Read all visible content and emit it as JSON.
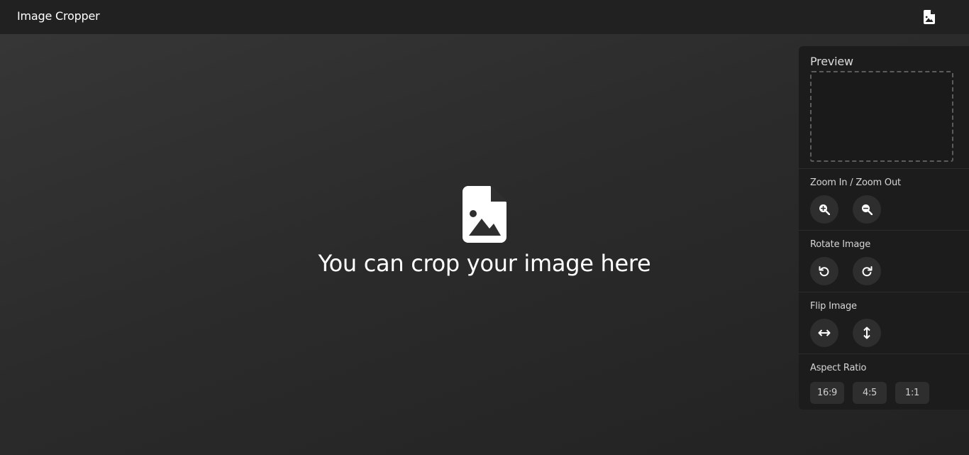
{
  "header": {
    "title": "Image Cropper",
    "open_icon": "file-image-icon"
  },
  "main": {
    "placeholder_icon": "file-image-icon",
    "placeholder_text": "You can crop your image here"
  },
  "panel": {
    "preview": {
      "title": "Preview"
    },
    "zoom": {
      "title": "Zoom In / Zoom Out",
      "buttons": [
        {
          "icon": "zoom-in-icon"
        },
        {
          "icon": "zoom-out-icon"
        }
      ]
    },
    "rotate": {
      "title": "Rotate Image",
      "buttons": [
        {
          "icon": "rotate-left-icon"
        },
        {
          "icon": "rotate-right-icon"
        }
      ]
    },
    "flip": {
      "title": "Flip Image",
      "buttons": [
        {
          "icon": "flip-horizontal-icon"
        },
        {
          "icon": "flip-vertical-icon"
        }
      ]
    },
    "aspect": {
      "title": "Aspect Ratio",
      "options": [
        "16:9",
        "4:5",
        "1:1"
      ]
    }
  },
  "colors": {
    "topbar": "#212121",
    "panel": "#1c1c1c",
    "button": "#2e2e2e",
    "text": "#ffffff"
  }
}
